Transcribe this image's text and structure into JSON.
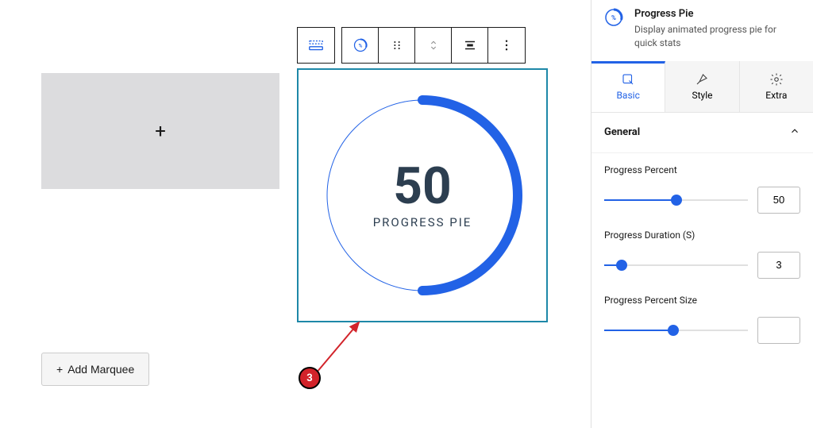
{
  "canvas": {
    "add_button_label": "Add Marquee"
  },
  "progress_pie": {
    "value": "50",
    "label": "PROGRESS PIE"
  },
  "annotation": {
    "badge": "3"
  },
  "sidebar": {
    "header": {
      "title": "Progress Pie",
      "description": "Display animated progress pie for quick stats"
    },
    "tabs": {
      "basic": "Basic",
      "style": "Style",
      "extra": "Extra"
    },
    "section": {
      "general": "General"
    },
    "fields": {
      "percent": {
        "label": "Progress Percent",
        "value": "50"
      },
      "duration": {
        "label": "Progress Duration (S)",
        "value": "3"
      },
      "percent_size": {
        "label": "Progress Percent Size",
        "value": ""
      }
    }
  }
}
